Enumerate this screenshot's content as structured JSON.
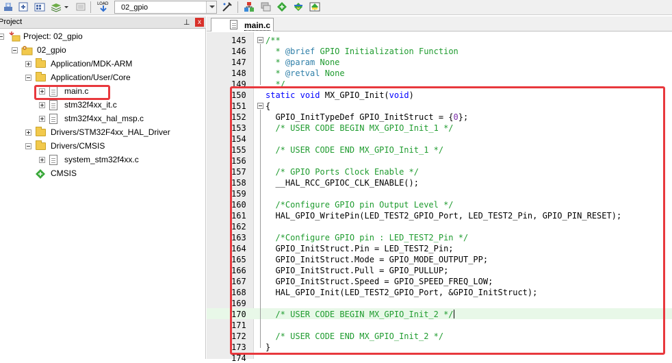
{
  "toolbar": {
    "target_name": "02_gpio",
    "icons": [
      "build-icon",
      "rebuild-icon",
      "batch-build-icon",
      "stack-icon",
      "stop-build-icon",
      "load-icon",
      "target-options-icon",
      "file-extensions-icon",
      "manage-components-icon",
      "select-packs-icon",
      "pack-installer-icon"
    ],
    "load_label": "LOAD"
  },
  "project_panel": {
    "title": "Project",
    "pin_glyph": "⊥",
    "close_glyph": "x",
    "tree": [
      {
        "label": "Project: 02_gpio",
        "icon": "project-icon"
      },
      {
        "label": "02_gpio",
        "icon": "target-icon"
      },
      {
        "label": "Application/MDK-ARM",
        "icon": "folder-icon"
      },
      {
        "label": "Application/User/Core",
        "icon": "folder-icon"
      },
      {
        "label": "main.c",
        "icon": "file-icon"
      },
      {
        "label": "stm32f4xx_it.c",
        "icon": "file-icon"
      },
      {
        "label": "stm32f4xx_hal_msp.c",
        "icon": "file-icon"
      },
      {
        "label": "Drivers/STM32F4xx_HAL_Driver",
        "icon": "folder-icon"
      },
      {
        "label": "Drivers/CMSIS",
        "icon": "folder-icon"
      },
      {
        "label": "system_stm32f4xx.c",
        "icon": "file-icon"
      },
      {
        "label": "CMSIS",
        "icon": "cmsis-component-icon"
      }
    ]
  },
  "editor": {
    "tab_label": "main.c",
    "lines": [
      {
        "n": "145",
        "t": "/**"
      },
      {
        "n": "146",
        "t": "  * @brief GPIO Initialization Function"
      },
      {
        "n": "147",
        "t": "  * @param None"
      },
      {
        "n": "148",
        "t": "  * @retval None"
      },
      {
        "n": "149",
        "t": "  */"
      },
      {
        "n": "150",
        "t": "static void MX_GPIO_Init(void)"
      },
      {
        "n": "151",
        "t": "{"
      },
      {
        "n": "152",
        "t": "  GPIO_InitTypeDef GPIO_InitStruct = {0};"
      },
      {
        "n": "153",
        "t": "  /* USER CODE BEGIN MX_GPIO_Init_1 */"
      },
      {
        "n": "154",
        "t": ""
      },
      {
        "n": "155",
        "t": "  /* USER CODE END MX_GPIO_Init_1 */"
      },
      {
        "n": "156",
        "t": ""
      },
      {
        "n": "157",
        "t": "  /* GPIO Ports Clock Enable */"
      },
      {
        "n": "158",
        "t": "  __HAL_RCC_GPIOC_CLK_ENABLE();"
      },
      {
        "n": "159",
        "t": ""
      },
      {
        "n": "160",
        "t": "  /*Configure GPIO pin Output Level */"
      },
      {
        "n": "161",
        "t": "  HAL_GPIO_WritePin(LED_TEST2_GPIO_Port, LED_TEST2_Pin, GPIO_PIN_RESET);"
      },
      {
        "n": "162",
        "t": ""
      },
      {
        "n": "163",
        "t": "  /*Configure GPIO pin : LED_TEST2_Pin */"
      },
      {
        "n": "164",
        "t": "  GPIO_InitStruct.Pin = LED_TEST2_Pin;"
      },
      {
        "n": "165",
        "t": "  GPIO_InitStruct.Mode = GPIO_MODE_OUTPUT_PP;"
      },
      {
        "n": "166",
        "t": "  GPIO_InitStruct.Pull = GPIO_PULLUP;"
      },
      {
        "n": "167",
        "t": "  GPIO_InitStruct.Speed = GPIO_SPEED_FREQ_LOW;"
      },
      {
        "n": "168",
        "t": "  HAL_GPIO_Init(LED_TEST2_GPIO_Port, &GPIO_InitStruct);"
      },
      {
        "n": "169",
        "t": ""
      },
      {
        "n": "170",
        "t": "  /* USER CODE BEGIN MX_GPIO_Init_2 */"
      },
      {
        "n": "171",
        "t": ""
      },
      {
        "n": "172",
        "t": "  /* USER CODE END MX_GPIO_Init_2 */"
      },
      {
        "n": "173",
        "t": "}"
      },
      {
        "n": "174",
        "t": ""
      }
    ]
  },
  "colors": {
    "annotation_red": "#e8383d",
    "comment_green": "#1e9b2e",
    "keyword_blue": "#0000ff",
    "current_line": "#e8f8e8"
  }
}
